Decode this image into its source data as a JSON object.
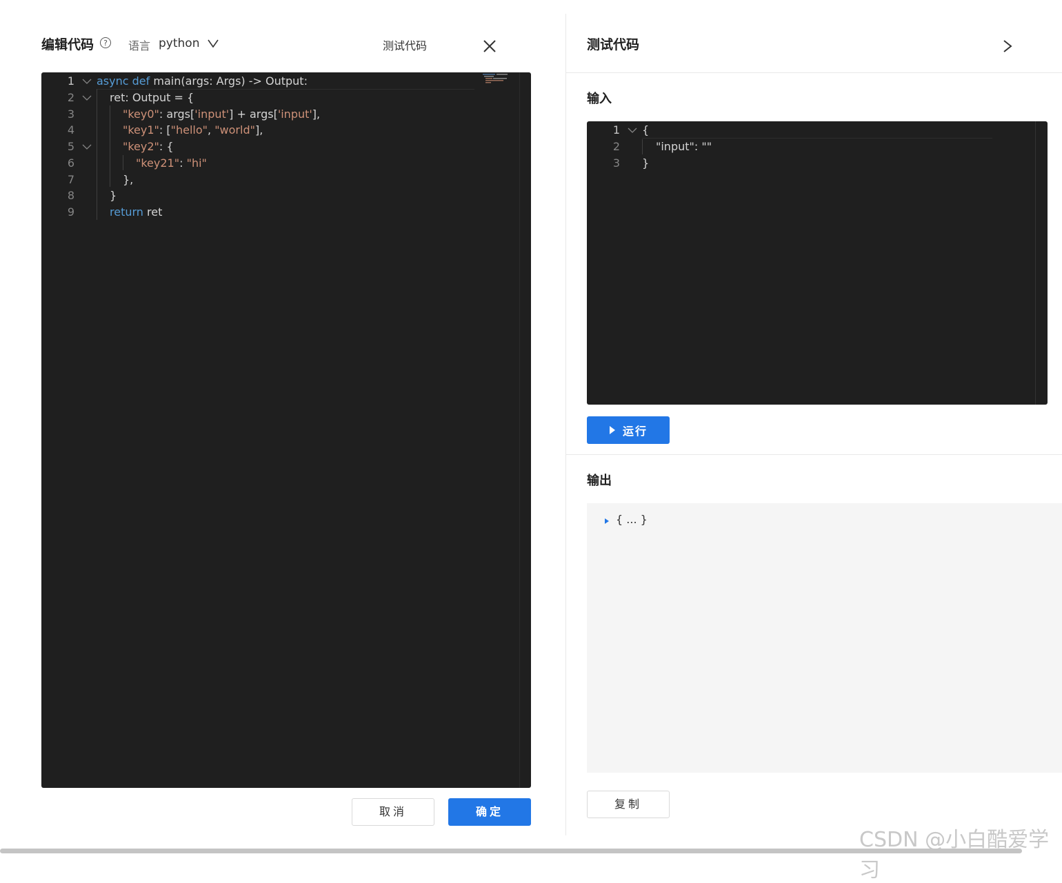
{
  "left_panel": {
    "title": "编辑代码",
    "help_icon": "?",
    "language_label": "语言",
    "language_value": "python",
    "test_code_link": "测试代码",
    "buttons": {
      "cancel": "取消",
      "confirm": "确定"
    }
  },
  "code_editor": {
    "line_numbers": [
      "1",
      "2",
      "3",
      "4",
      "5",
      "6",
      "7",
      "8",
      "9"
    ],
    "lines": {
      "l1": {
        "kw_async": "async",
        "kw_def": "def",
        "rest": "main(args: Args) -> Output:"
      },
      "l2": {
        "text": "ret: Output = {"
      },
      "l3": {
        "s1": "\"key0\"",
        "t1": ": args[",
        "s2": "'input'",
        "t2": "] + args[",
        "s3": "'input'",
        "t3": "],"
      },
      "l4": {
        "s1": "\"key1\"",
        "t1": ": [",
        "s2": "\"hello\"",
        "t2": ", ",
        "s3": "\"world\"",
        "t3": "],"
      },
      "l5": {
        "s1": "\"key2\"",
        "t1": ": {"
      },
      "l6": {
        "s1": "\"key21\"",
        "t1": ": ",
        "s2": "\"hi\""
      },
      "l7": {
        "text": "},"
      },
      "l8": {
        "text": "}"
      },
      "l9": {
        "kw": "return",
        "rest": " ret"
      }
    }
  },
  "right_panel": {
    "title": "测试代码",
    "input_label": "输入",
    "input_editor": {
      "line_numbers": [
        "1",
        "2",
        "3"
      ],
      "lines": [
        "{",
        "\"input\": \"\"",
        "}"
      ]
    },
    "run_button": "运行",
    "output_label": "输出",
    "output_value": "{ ... }",
    "copy_button": "复制"
  },
  "watermark": "CSDN @小白酷爱学习",
  "icons": {
    "help": "question-circle-icon",
    "language_dropdown": "chevron-down-icon",
    "close": "close-icon",
    "collapse": "chevron-right-icon",
    "run": "play-icon",
    "output_expand": "caret-right-icon"
  },
  "colors": {
    "primary": "#2277e6",
    "editor_bg": "#1f1f1f",
    "keyword": "#569cd6",
    "string": "#ce9178",
    "text": "#d4d4d4"
  }
}
